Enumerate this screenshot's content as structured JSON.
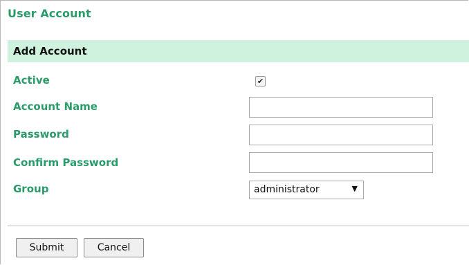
{
  "page": {
    "title": "User Account"
  },
  "section": {
    "title": "Add Account"
  },
  "form": {
    "active": {
      "label": "Active",
      "checked": true,
      "check_glyph": "✔"
    },
    "account_name": {
      "label": "Account Name",
      "value": ""
    },
    "password": {
      "label": "Password",
      "value": ""
    },
    "confirm_password": {
      "label": "Confirm Password",
      "value": ""
    },
    "group": {
      "label": "Group",
      "selected": "administrator",
      "arrow_glyph": "▼"
    }
  },
  "buttons": {
    "submit": "Submit",
    "cancel": "Cancel"
  },
  "colors": {
    "accent_green": "#2b9b6a",
    "section_bg": "#cef2de"
  },
  "icons": {
    "check": "checkmark-icon",
    "dropdown": "chevron-down-icon"
  }
}
